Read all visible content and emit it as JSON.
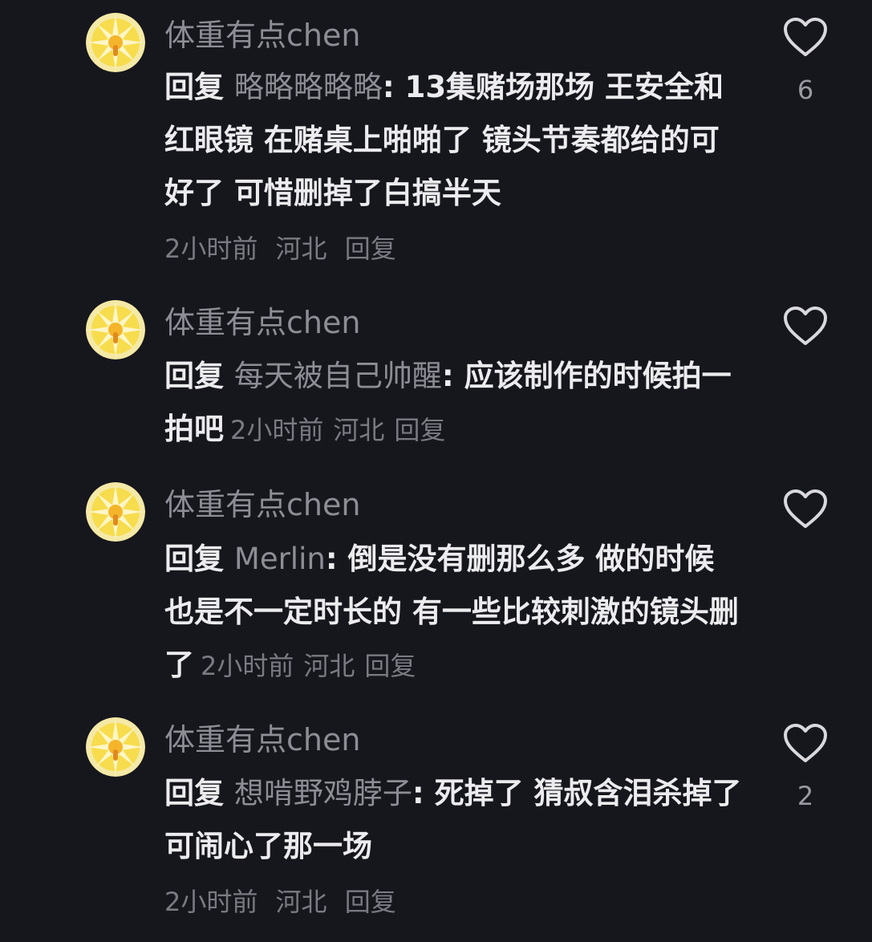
{
  "comments": [
    {
      "username": "体重有点chen",
      "reply_word": "回复",
      "reply_target": "略略略略略",
      "text": ": 13集赌场那场 王安全和红眼镜 在赌桌上啪啪了 镜头节奏都给的可好了 可惜删掉了白搞半天",
      "time": "2小时前",
      "location": "河北",
      "reply_label": "回复",
      "likes": "6"
    },
    {
      "username": "体重有点chen",
      "reply_word": "回复",
      "reply_target": "每天被自己帅醒",
      "text": ": 应该制作的时候拍一拍吧",
      "time": "2小时前",
      "location": "河北",
      "reply_label": "回复",
      "likes": ""
    },
    {
      "username": "体重有点chen",
      "reply_word": "回复",
      "reply_target": "Merlin",
      "text": ": 倒是没有删那么多 做的时候也是不一定时长的 有一些比较刺激的镜头删了",
      "time": "2小时前",
      "location": "河北",
      "reply_label": "回复",
      "likes": ""
    },
    {
      "username": "体重有点chen",
      "reply_word": "回复",
      "reply_target": "想啃野鸡脖子",
      "text": ": 死掉了 猜叔含泪杀掉了 可闹心了那一场",
      "time": "2小时前",
      "location": "河北",
      "reply_label": "回复",
      "likes": "2"
    }
  ],
  "colors": {
    "background": "#16161d",
    "username": "#8d8d95",
    "body": "#ececef",
    "meta": "#7a7a82",
    "avatar_yellow": "#f1d23a"
  },
  "icons": {
    "avatar": "sun-avatar-icon",
    "like": "heart-outline-icon"
  }
}
